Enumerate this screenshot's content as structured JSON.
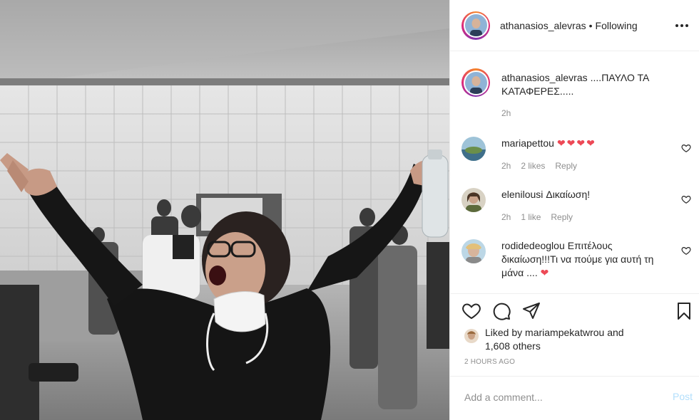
{
  "header": {
    "username": "athanasios_alevras",
    "separator": "•",
    "follow_state": "Following",
    "more_icon": "more-horizontal-icon"
  },
  "caption": {
    "username": "athanasios_alevras",
    "text": "....ΠΑΥΛΟ ΤΑ ΚΑΤΑΦΕΡΕΣ.....",
    "time": "2h"
  },
  "comments": [
    {
      "username": "mariapettou",
      "text": "❤❤❤❤",
      "time": "2h",
      "likes": "2 likes",
      "reply": "Reply"
    },
    {
      "username": "elenilousi",
      "text": "Δικαίωση!",
      "time": "2h",
      "likes": "1 like",
      "reply": "Reply"
    },
    {
      "username": "rodidedeoglou",
      "text": "Επιτέλους δικαίωση!!!Τι να πούμε για αυτή τη μάνα ....",
      "heart": "❤"
    }
  ],
  "actions": {
    "like_icon": "heart-icon",
    "comment_icon": "comment-icon",
    "share_icon": "paper-plane-icon",
    "save_icon": "bookmark-icon"
  },
  "likes": {
    "prefix": "Liked by",
    "user": "mariampekatwrou",
    "and": "and",
    "others": "1,608 others"
  },
  "timestamp": "2 HOURS AGO",
  "add_comment": {
    "placeholder": "Add a comment...",
    "post_label": "Post"
  },
  "colors": {
    "text": "#262626",
    "secondary": "#8e8e8e",
    "heart": "#ed4956",
    "post_disabled": "#b2dffc",
    "divider": "#efefef"
  }
}
